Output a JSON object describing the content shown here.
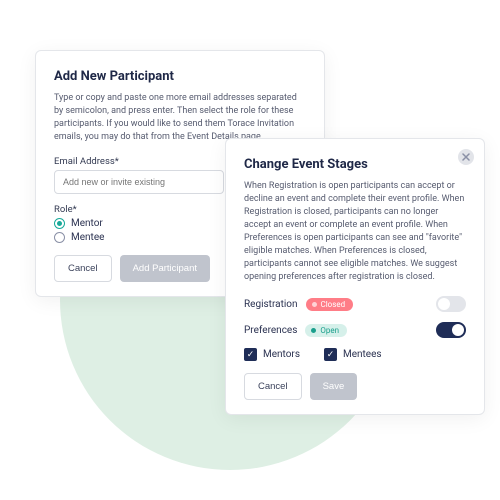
{
  "leftCard": {
    "title": "Add New Participant",
    "desc": "Type or copy and paste one more email addresses separated by semicolon, and press enter. Then select the role for these participants. If you would like to send them Torace Invitation emails, you may do that from the Event Details page.",
    "emailLabel": "Email Address*",
    "emailPlaceholder": "Add new or invite existing",
    "roleLabel": "Role*",
    "roles": {
      "mentor": "Mentor",
      "mentee": "Mentee"
    },
    "cancel": "Cancel",
    "submit": "Add Participant"
  },
  "rightCard": {
    "title": "Change Event Stages",
    "desc": "When Registration is open participants can accept or decline an event and complete their event profile. When Registration is closed, participants can no longer accept an event or complete an event profile. When Preferences is open participants can see and \"favorite\" eligible matches. When Preferences is closed, participants cannot see eligible matches. We suggest opening preferences after registration is closed.",
    "regLabel": "Registration",
    "regStatus": "Closed",
    "prefLabel": "Preferences",
    "prefStatus": "Open",
    "mentorsLabel": "Mentors",
    "menteesLabel": "Mentees",
    "cancel": "Cancel",
    "save": "Save"
  }
}
